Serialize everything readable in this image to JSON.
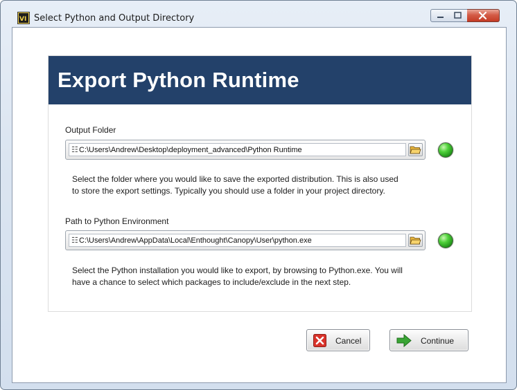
{
  "window": {
    "title": "Select Python and Output Directory",
    "controls": [
      "minimize-icon",
      "maximize-icon",
      "close-icon"
    ]
  },
  "banner": {
    "title": "Export Python Runtime"
  },
  "output_folder": {
    "label": "Output Folder",
    "path": "C:\\Users\\Andrew\\Desktop\\deployment_advanced\\Python Runtime",
    "description_line1": "Select the folder where you would like to save the exported distribution.  This is also used",
    "description_line2": "to store the export settings.  Typically you should use a folder in your project directory.",
    "status_color": "#3ec231"
  },
  "python_env": {
    "label": "Path to Python Environment",
    "path": "C:\\Users\\Andrew\\AppData\\Local\\Enthought\\Canopy\\User\\python.exe",
    "description_line1": "Select the Python installation you would like to export, by browsing to Python.exe.  You will",
    "description_line2": "have a chance to select which packages to include/exclude in the next step.",
    "status_color": "#3ec231"
  },
  "buttons": {
    "cancel": "Cancel",
    "continue": "Continue"
  },
  "colors": {
    "banner": "#23416a",
    "cancel_icon": "#d9332a",
    "continue_icon": "#3aa535"
  }
}
